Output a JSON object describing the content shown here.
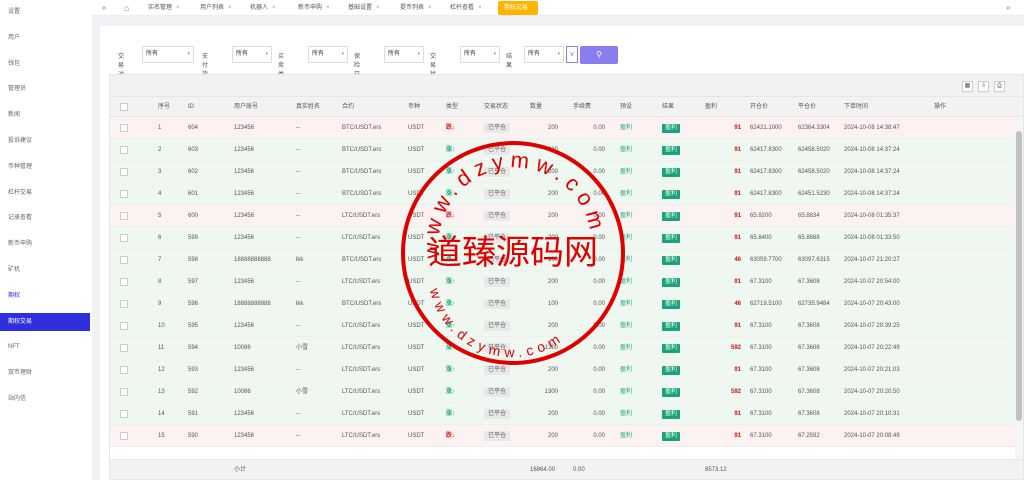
{
  "sidebar": {
    "items": [
      {
        "label": "设置",
        "active": false
      },
      {
        "label": "用户",
        "active": false
      },
      {
        "label": "钱包",
        "active": false
      },
      {
        "label": "管理员",
        "active": false
      },
      {
        "label": "新闻",
        "active": false
      },
      {
        "label": "投诉建议",
        "active": false
      },
      {
        "label": "币种管理",
        "active": false
      },
      {
        "label": "杠杆交易",
        "active": false
      },
      {
        "label": "记录查看",
        "active": false
      },
      {
        "label": "新币申购",
        "active": false
      },
      {
        "label": "矿机",
        "active": false
      },
      {
        "label": "期权",
        "active": false
      },
      {
        "label": "期权交易",
        "active": true
      },
      {
        "label": "NFT",
        "active": false
      },
      {
        "label": "双币理财",
        "active": false
      },
      {
        "label": "站内信",
        "active": false
      }
    ]
  },
  "tabs": {
    "items": [
      {
        "label": "实名管理",
        "close": "×"
      },
      {
        "label": "用户列表",
        "close": "×"
      },
      {
        "label": "机器人",
        "close": "×"
      },
      {
        "label": "新币申购",
        "close": "×"
      },
      {
        "label": "基础设置",
        "close": "×"
      },
      {
        "label": "提币列表",
        "close": "×"
      },
      {
        "label": "杠杆查看",
        "close": "×"
      },
      {
        "label": "期权交易",
        "close": ""
      }
    ],
    "prev_icon": "«",
    "home_icon": "⌂",
    "next_icon": "»"
  },
  "filters": {
    "items": [
      {
        "label": "交易对",
        "value": "所有"
      },
      {
        "label": "支付货币",
        "value": "所有"
      },
      {
        "label": "买卖类型",
        "value": "所有"
      },
      {
        "label": "保险交易",
        "value": "所有"
      },
      {
        "label": "交易状态",
        "value": "所有"
      },
      {
        "label": "结果",
        "value": "所有"
      }
    ],
    "search_icon": "⚲",
    "collapse_icon": "∨"
  },
  "toolbar": {
    "filter_icon": "▦",
    "export_icon": "⇩",
    "print_icon": "⎙"
  },
  "columns": [
    "序号",
    "ID",
    "用户账号",
    "真实姓名",
    "合约",
    "币种",
    "类型",
    "交易状态",
    "数量",
    "手续费",
    "预设",
    "结果",
    "盈利",
    "开仓价",
    "平仓价",
    "下单时间",
    "操作"
  ],
  "rows": [
    {
      "seq": "1",
      "id": "604",
      "account": "123456",
      "name": "--",
      "contract": "BTC/USDT.ers",
      "coin": "USDT",
      "dir": "跌↓",
      "up": false,
      "status": "已平仓",
      "qty": "200",
      "fee": "0.00",
      "preset": "盈利",
      "result": "盈利",
      "profit": "91",
      "open": "62421.1000",
      "close": "62364.3304",
      "time": "2024-10-08 14:38:47"
    },
    {
      "seq": "2",
      "id": "603",
      "account": "123456",
      "name": "--",
      "contract": "BTC/USDT.ers",
      "coin": "USDT",
      "dir": "涨↑",
      "up": true,
      "status": "已平仓",
      "qty": "200",
      "fee": "0.00",
      "preset": "盈利",
      "result": "盈利",
      "profit": "91",
      "open": "62417.8300",
      "close": "62458.5020",
      "time": "2024-10-08 14:37:24"
    },
    {
      "seq": "3",
      "id": "602",
      "account": "123456",
      "name": "--",
      "contract": "BTC/USDT.ers",
      "coin": "USDT",
      "dir": "涨↑",
      "up": true,
      "status": "已平仓",
      "qty": "200",
      "fee": "0.00",
      "preset": "盈利",
      "result": "盈利",
      "profit": "91",
      "open": "62417.8300",
      "close": "62458.5020",
      "time": "2024-10-08 14:37:24"
    },
    {
      "seq": "4",
      "id": "601",
      "account": "123456",
      "name": "--",
      "contract": "BTC/USDT.ers",
      "coin": "USDT",
      "dir": "涨↑",
      "up": true,
      "status": "已平仓",
      "qty": "200",
      "fee": "0.00",
      "preset": "盈利",
      "result": "盈利",
      "profit": "91",
      "open": "62417.8300",
      "close": "62451.5230",
      "time": "2024-10-08 14:37:24"
    },
    {
      "seq": "5",
      "id": "600",
      "account": "123456",
      "name": "--",
      "contract": "LTC/USDT.ers",
      "coin": "USDT",
      "dir": "跌↓",
      "up": false,
      "status": "已平仓",
      "qty": "200",
      "fee": "0.00",
      "preset": "盈利",
      "result": "盈利",
      "profit": "91",
      "open": "65.9200",
      "close": "65.8834",
      "time": "2024-10-08 01:35:37"
    },
    {
      "seq": "6",
      "id": "599",
      "account": "123456",
      "name": "--",
      "contract": "LTC/USDT.ers",
      "coin": "USDT",
      "dir": "涨↑",
      "up": true,
      "status": "已平仓",
      "qty": "200",
      "fee": "0.00",
      "preset": "盈利",
      "result": "盈利",
      "profit": "91",
      "open": "65.8400",
      "close": "65.8868",
      "time": "2024-10-08 01:33:50"
    },
    {
      "seq": "7",
      "id": "598",
      "account": "18888888888",
      "name": "lkk",
      "contract": "BTC/USDT.ers",
      "coin": "USDT",
      "dir": "涨↑",
      "up": true,
      "status": "已平仓",
      "qty": "100",
      "fee": "0.00",
      "preset": "盈利",
      "result": "盈利",
      "profit": "46",
      "open": "63059.7700",
      "close": "63097.6315",
      "time": "2024-10-07 21:20:27"
    },
    {
      "seq": "8",
      "id": "597",
      "account": "123456",
      "name": "--",
      "contract": "LTC/USDT.ers",
      "coin": "USDT",
      "dir": "涨↑",
      "up": true,
      "status": "已平仓",
      "qty": "200",
      "fee": "0.00",
      "preset": "盈利",
      "result": "盈利",
      "profit": "91",
      "open": "67.3100",
      "close": "67.3608",
      "time": "2024-10-07 20:54:00"
    },
    {
      "seq": "9",
      "id": "596",
      "account": "18888888888",
      "name": "lkk",
      "contract": "BTC/USDT.ers",
      "coin": "USDT",
      "dir": "涨↑",
      "up": true,
      "status": "已平仓",
      "qty": "100",
      "fee": "0.00",
      "preset": "盈利",
      "result": "盈利",
      "profit": "46",
      "open": "62719.5100",
      "close": "62735.9484",
      "time": "2024-10-07 20:43:00"
    },
    {
      "seq": "10",
      "id": "595",
      "account": "123456",
      "name": "--",
      "contract": "LTC/USDT.ers",
      "coin": "USDT",
      "dir": "涨↑",
      "up": true,
      "status": "已平仓",
      "qty": "200",
      "fee": "0.00",
      "preset": "盈利",
      "result": "盈利",
      "profit": "91",
      "open": "67.3100",
      "close": "67.3608",
      "time": "2024-10-07 20:39:25"
    },
    {
      "seq": "11",
      "id": "594",
      "account": "10086",
      "name": "小雪",
      "contract": "LTC/USDT.ers",
      "coin": "USDT",
      "dir": "涨↑",
      "up": true,
      "status": "已平仓",
      "qty": "1300",
      "fee": "0.00",
      "preset": "盈利",
      "result": "盈利",
      "profit": "592",
      "open": "67.3100",
      "close": "67.3608",
      "time": "2024-10-07 20:22:49"
    },
    {
      "seq": "12",
      "id": "593",
      "account": "123456",
      "name": "--",
      "contract": "LTC/USDT.ers",
      "coin": "USDT",
      "dir": "涨↑",
      "up": true,
      "status": "已平仓",
      "qty": "200",
      "fee": "0.00",
      "preset": "盈利",
      "result": "盈利",
      "profit": "91",
      "open": "67.3100",
      "close": "67.3608",
      "time": "2024-10-07 20:21:03"
    },
    {
      "seq": "13",
      "id": "592",
      "account": "10086",
      "name": "小雪",
      "contract": "LTC/USDT.ers",
      "coin": "USDT",
      "dir": "涨↑",
      "up": true,
      "status": "已平仓",
      "qty": "1300",
      "fee": "0.00",
      "preset": "盈利",
      "result": "盈利",
      "profit": "592",
      "open": "67.3100",
      "close": "67.3608",
      "time": "2024-10-07 20:20:50"
    },
    {
      "seq": "14",
      "id": "591",
      "account": "123456",
      "name": "--",
      "contract": "LTC/USDT.ers",
      "coin": "USDT",
      "dir": "涨↑",
      "up": true,
      "status": "已平仓",
      "qty": "200",
      "fee": "0.00",
      "preset": "盈利",
      "result": "盈利",
      "profit": "91",
      "open": "67.3100",
      "close": "67.3608",
      "time": "2024-10-07 20:10:31"
    },
    {
      "seq": "15",
      "id": "590",
      "account": "123456",
      "name": "--",
      "contract": "LTC/USDT.ers",
      "coin": "USDT",
      "dir": "跌↓",
      "up": false,
      "status": "已平仓",
      "qty": "200",
      "fee": "0.00",
      "preset": "盈利",
      "result": "盈利",
      "profit": "91",
      "open": "67.3100",
      "close": "67.2592",
      "time": "2024-10-07 20:08:49"
    }
  ],
  "footer": {
    "subtotal_label": "小计",
    "qty_total": "16864.00",
    "fee_total": "0.00",
    "profit_total": "8573.12"
  },
  "watermark": {
    "url_top": "www.dzymw.com",
    "url_bottom": "www.dzymw.com",
    "name": "道臻源码网",
    "color": "#e00000"
  }
}
